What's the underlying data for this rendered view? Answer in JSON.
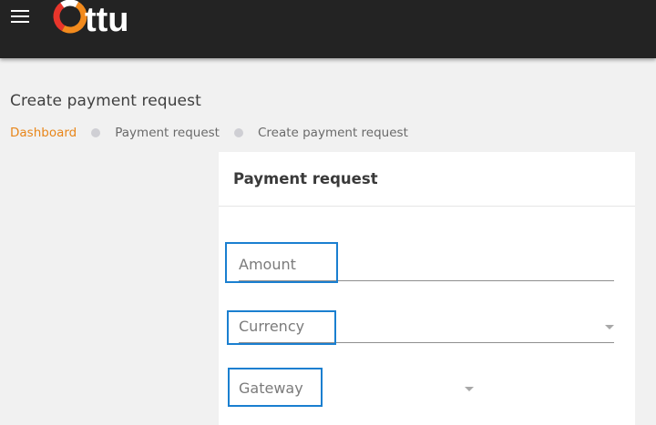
{
  "app": {
    "logo_text": "Ottu"
  },
  "header": {
    "menu_icon": "hamburger-menu-icon"
  },
  "page": {
    "title": "Create payment request"
  },
  "breadcrumb": {
    "items": [
      {
        "label": "Dashboard",
        "active": true
      },
      {
        "label": "Payment request",
        "active": false
      },
      {
        "label": "Create payment request",
        "active": false
      }
    ]
  },
  "card": {
    "title": "Payment request",
    "fields": [
      {
        "placeholder": "Amount",
        "type": "text"
      },
      {
        "placeholder": "Currency",
        "type": "select"
      },
      {
        "placeholder": "Gateway",
        "type": "select"
      }
    ]
  },
  "colors": {
    "topbar": "#232323",
    "accent_orange": "#e8861a",
    "logo_red": "#e8352b",
    "logo_orange": "#f28a1d",
    "highlight_blue": "#1a7fd0"
  }
}
